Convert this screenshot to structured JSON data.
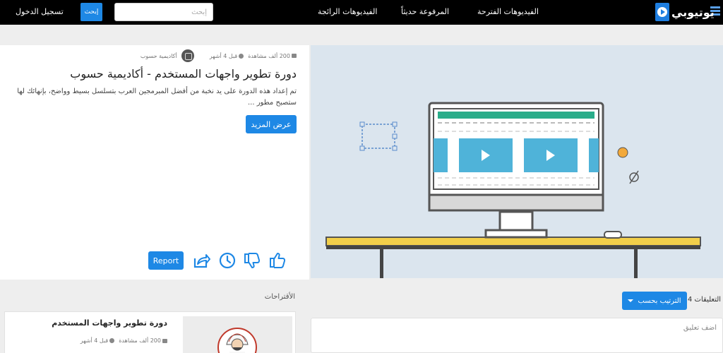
{
  "header": {
    "logo_text": "يوتيوبي",
    "nav": [
      "الفيديوهات الفترحة",
      "المرفوعة حديثاً",
      "الفيديوهات الرائجة"
    ],
    "search_placeholder": "إبحث",
    "search_button": "إبحث",
    "login": "تسجيل الدخول"
  },
  "video": {
    "views": "200 ألف مشاهدة",
    "time_ago": "قبل 4 أشهر",
    "channel": "أكاديمية حسوب",
    "title": "دورة تطوير واجهات المستخدم - أكاديمية حسوب",
    "description": "تم إعداد هذه الدورة على يد نخبة من أفضل المبرمجين العرب بتسلسل بسيط وواضح، بإنهائك لها ستصبح مطور ...",
    "more_button": "عرض المزيد",
    "report_button": "Report",
    "actions": [
      "like-icon",
      "dislike-icon",
      "watch-later-icon",
      "share-icon"
    ]
  },
  "suggestions": {
    "title": "الأقتراحات",
    "items": [
      {
        "title": "دورة تطوير واجهات المستخدم",
        "views": "200 ألف مشاهدة",
        "time_ago": "قبل 4 أشهر"
      }
    ]
  },
  "comments": {
    "count_label": "التعليقات 4",
    "sort_button": "الترتيب بحسب",
    "placeholder": "اضف تعليق"
  },
  "colors": {
    "accent": "#1e88e5",
    "topbar": "#000000",
    "background": "#eeeeee"
  }
}
